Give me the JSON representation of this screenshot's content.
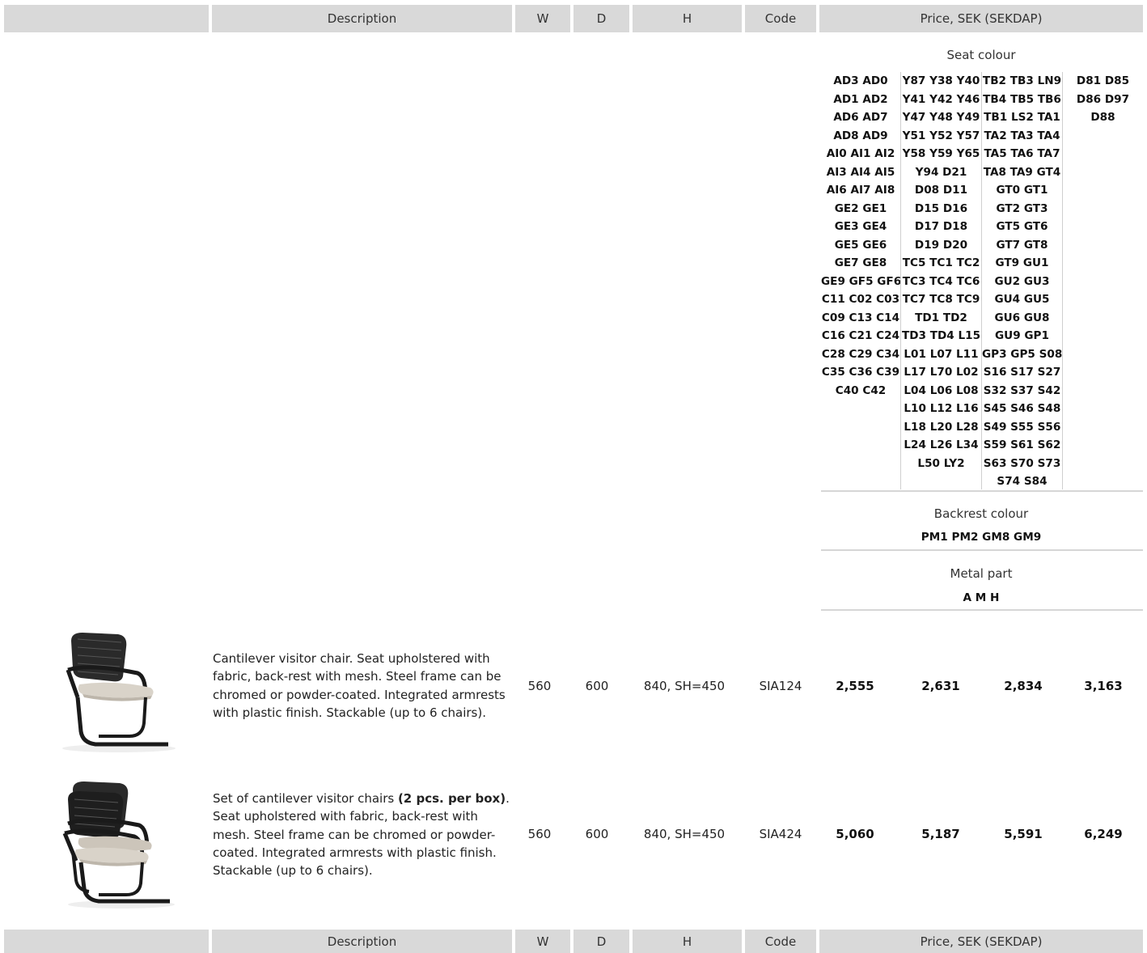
{
  "header": {
    "description": "Description",
    "w": "W",
    "d": "D",
    "h": "H",
    "code": "Code",
    "price": "Price, SEK (SEKDAP)"
  },
  "seat_colour": {
    "label": "Seat colour",
    "col1": [
      "AD3 AD0",
      "AD1 AD2",
      "AD6 AD7",
      "AD8 AD9",
      "AI0 AI1 AI2",
      "AI3 AI4 AI5",
      "AI6 AI7 AI8",
      "GE2 GE1",
      "GE3 GE4",
      "GE5 GE6",
      "GE7 GE8",
      "GE9 GF5 GF6",
      "C11 C02 C03",
      "C09 C13 C14",
      "C16 C21 C24",
      "C28 C29 C34",
      "C35 C36 C39",
      "C40 C42"
    ],
    "col2": [
      "Y87 Y38 Y40",
      "Y41 Y42 Y46",
      "Y47 Y48 Y49",
      "Y51 Y52 Y57",
      "Y58 Y59 Y65",
      "Y94 D21",
      "D08 D11",
      "D15 D16",
      "D17 D18",
      "D19 D20",
      "TC5 TC1 TC2",
      "TC3 TC4 TC6",
      "TC7 TC8 TC9",
      "TD1 TD2",
      "TD3 TD4 L15",
      "L01 L07 L11",
      "L17 L70 L02",
      "L04 L06 L08",
      "L10 L12 L16",
      "L18 L20 L28",
      "L24 L26 L34",
      "L50 LY2"
    ],
    "col3": [
      "TB2 TB3 LN9",
      "TB4 TB5 TB6",
      "TB1 LS2 TA1",
      "TA2 TA3 TA4",
      "TA5 TA6 TA7",
      "TA8 TA9 GT4",
      "GT0 GT1",
      "GT2 GT3",
      "GT5 GT6",
      "GT7 GT8",
      "GT9 GU1",
      "GU2 GU3",
      "GU4 GU5",
      "GU6 GU8",
      "GU9 GP1",
      "GP3 GP5 S08",
      "S16 S17 S27",
      "S32 S37 S42",
      "S45 S46 S48",
      "S49 S55 S56",
      "S59 S61 S62",
      "S63 S70 S73",
      "S74 S84"
    ],
    "col4": [
      "D81 D85",
      "D86 D97",
      "D88"
    ]
  },
  "backrest_colour": {
    "label": "Backrest colour",
    "codes": "PM1 PM2 GM8 GM9"
  },
  "metal_part": {
    "label": "Metal part",
    "codes": "A M H"
  },
  "products": [
    {
      "description": "Cantilever visitor chair. Seat upholstered with fabric, back-rest with mesh. Steel frame can be chromed or powder-coated. Integrated armrests with plastic finish. Stackable (up to 6 chairs).",
      "w": "560",
      "d": "600",
      "h": "840, SH=450",
      "code": "SIA124",
      "prices": [
        "2,555",
        "2,631",
        "2,834",
        "3,163"
      ]
    },
    {
      "description_prefix": "Set of cantilever visitor chairs ",
      "description_bold": "(2 pcs. per box)",
      "description_suffix": ". Seat upholstered with fabric, back-rest with mesh. Steel frame can be chromed or powder-coated. Integrated armrests with plastic finish. Stackable (up to 6 chairs).",
      "w": "560",
      "d": "600",
      "h": "840, SH=450",
      "code": "SIA424",
      "prices": [
        "5,060",
        "5,187",
        "5,591",
        "6,249"
      ]
    }
  ],
  "colors": {
    "header_bg": "#d9d9d9",
    "divider": "#d6d6d6",
    "frame": "#1a1a1a",
    "seat": "#d8d2c8"
  }
}
